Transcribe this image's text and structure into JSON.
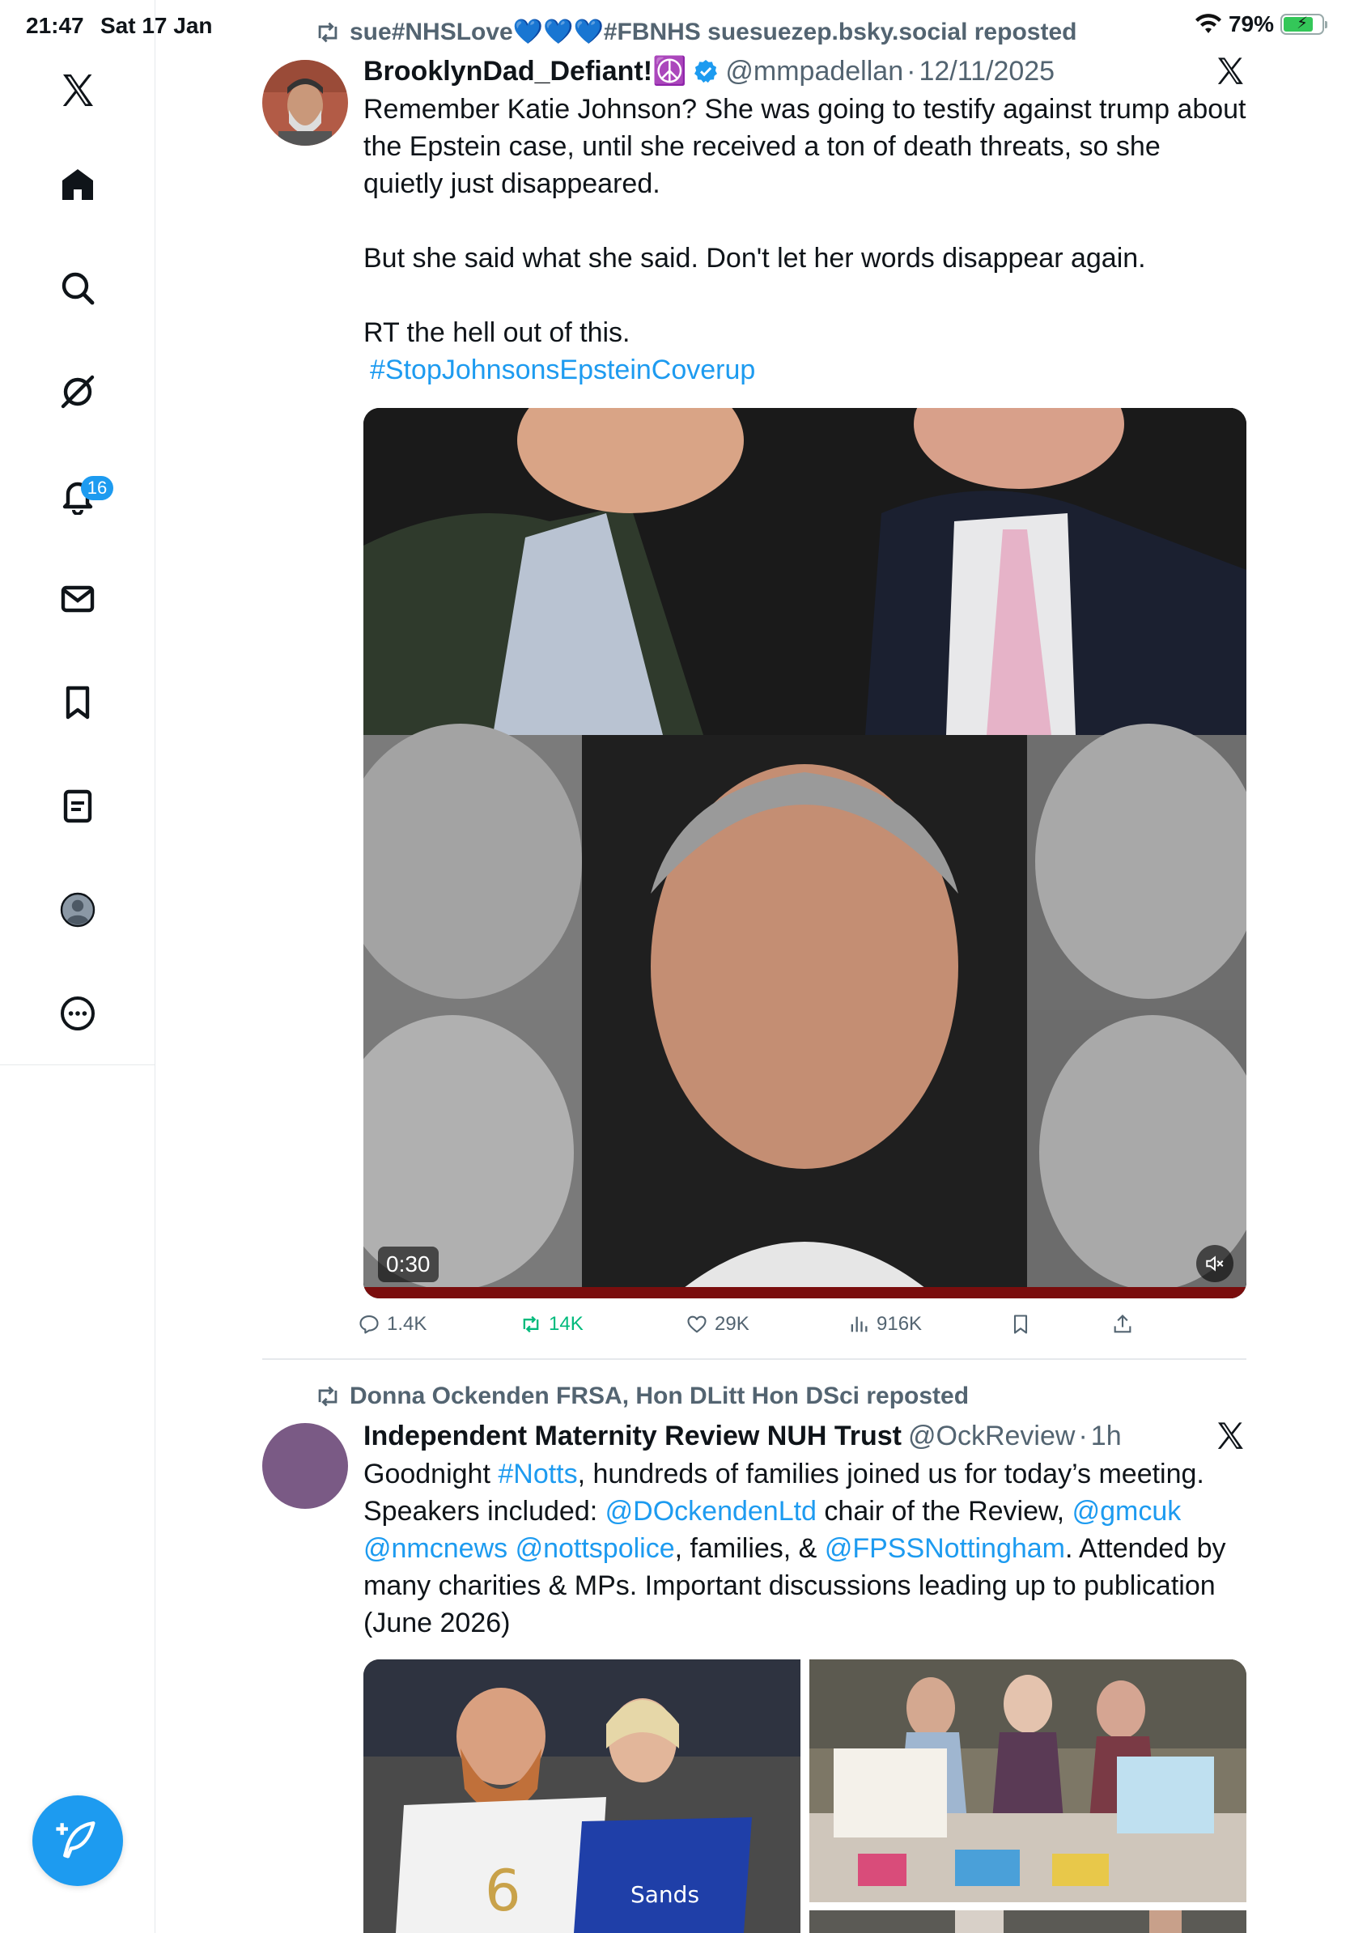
{
  "status_bar": {
    "time": "21:47",
    "date": "Sat 17 Jan",
    "battery": "79%",
    "battery_level": 0.79
  },
  "sidebar": {
    "items": [
      {
        "name": "x-logo-icon",
        "label": "X"
      },
      {
        "name": "home-icon",
        "label": "Home"
      },
      {
        "name": "search-icon",
        "label": "Search"
      },
      {
        "name": "grok-icon",
        "label": "Grok"
      },
      {
        "name": "notifications-icon",
        "label": "Notifications",
        "badge": "16"
      },
      {
        "name": "messages-icon",
        "label": "Messages"
      },
      {
        "name": "bookmarks-icon",
        "label": "Bookmarks"
      },
      {
        "name": "lists-icon",
        "label": "Lists"
      },
      {
        "name": "profile-icon",
        "label": "Profile"
      },
      {
        "name": "more-icon",
        "label": "More"
      }
    ],
    "notification_badge": "16",
    "compose_icon": "compose-icon"
  },
  "posts": [
    {
      "repost_by": "sue#NHSLove💙💙💙#FBNHS suesuezep.bsky.social reposted",
      "author": "BrooklynDad_Defiant!☮️",
      "verified": true,
      "handle": "@mmpadellan",
      "time": "12/11/2025",
      "text": [
        "Remember Katie Johnson? She was going to testify against trump about the Epstein case, until she received a ton of death threats, so she quietly just disappeared.",
        "",
        "But she said what she said. Don't let her words disappear again.",
        "",
        "RT the hell out of this."
      ],
      "hashtag": "#StopJohnsonsEpsteinCoverup",
      "video_duration": "0:30",
      "stats": {
        "replies": "1.4K",
        "reposts": "14K",
        "likes": "29K",
        "views": "916K"
      }
    },
    {
      "repost_by": "Donna Ockenden FRSA, Hon DLitt Hon DSci reposted",
      "author": "Independent Maternity Review NUH Trust",
      "handle": "@OckReview",
      "time": "1h",
      "text_parts": {
        "p1": "Goodnight ",
        "tag1": "#Notts",
        "p2": ", hundreds of families joined us for today’s meeting. Speakers included: ",
        "m1": "@DOckendenLtd",
        "p3": " chair of the Review, ",
        "m2": "@gmcuk",
        "m3": "@nmcnews",
        "m4": "@nottspolice",
        "p4": ", families, & ",
        "m5": "@FPSSNottingham",
        "p5": ". Attended by many charities & MPs. Important discussions leading up to publication (June 2026)"
      },
      "avatar_color": "#7a5a85"
    }
  ],
  "colors": {
    "accent": "#1d9bf0",
    "repost_green": "#00ba7c",
    "muted": "#536471"
  }
}
